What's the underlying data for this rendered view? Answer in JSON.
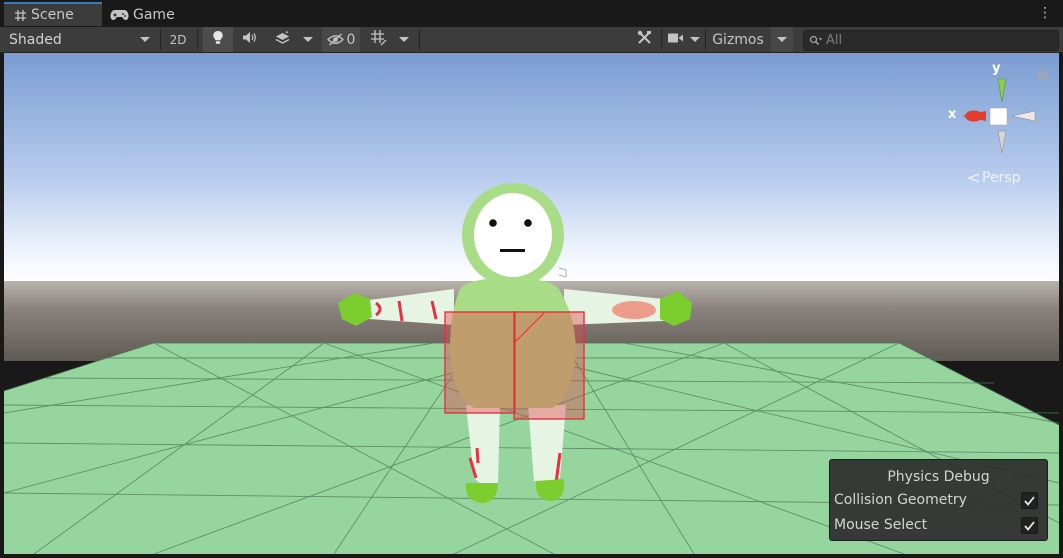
{
  "tabs": [
    {
      "label": "Scene",
      "icon": "grid-icon",
      "active": true
    },
    {
      "label": "Game",
      "icon": "gamepad-icon",
      "active": false
    }
  ],
  "toolbar": {
    "shading_mode": "Shaded",
    "mode_2d": "2D",
    "hidden_count": "0",
    "gizmos_label": "Gizmos",
    "search_placeholder": "All"
  },
  "gizmo": {
    "x_label": "x",
    "y_label": "y",
    "projection": "Persp"
  },
  "physics_debug": {
    "title": "Physics Debug",
    "rows": [
      {
        "label": "Collision Geometry",
        "checked": true
      },
      {
        "label": "Mouse Select",
        "checked": true
      }
    ]
  },
  "colors": {
    "ground": "#97d59f",
    "character": "#a8dc86",
    "collider": "#e83040",
    "axis_x": "#e23e2e",
    "axis_y": "#8ad14b"
  }
}
